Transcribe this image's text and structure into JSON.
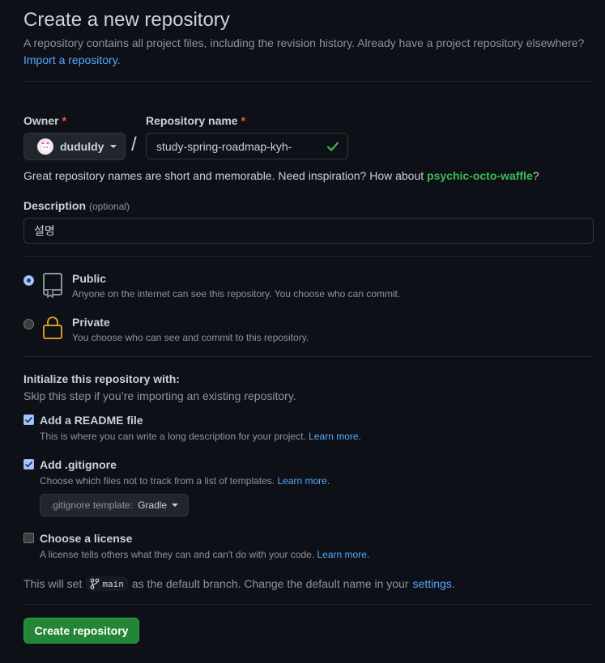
{
  "header": {
    "title": "Create a new repository",
    "subtitle": "A repository contains all project files, including the revision history. Already have a project repository elsewhere?",
    "import_link": "Import a repository."
  },
  "owner": {
    "label": "Owner",
    "required_mark": "*",
    "value": "duduldy"
  },
  "repo_name": {
    "label": "Repository name",
    "required_mark": "*",
    "value": "study-spring-roadmap-kyh-"
  },
  "hint": {
    "prefix": "Great repository names are short and memorable. Need inspiration? How about ",
    "suggestion": "psychic-octo-waffle",
    "suffix": "?"
  },
  "description": {
    "label": "Description",
    "optional": "(optional)",
    "value": "설명"
  },
  "visibility": {
    "public": {
      "title": "Public",
      "desc": "Anyone on the internet can see this repository. You choose who can commit.",
      "selected": true
    },
    "private": {
      "title": "Private",
      "desc": "You choose who can see and commit to this repository.",
      "selected": false
    }
  },
  "init": {
    "title": "Initialize this repository with:",
    "subtitle": "Skip this step if you’re importing an existing repository.",
    "readme": {
      "title": "Add a README file",
      "desc": "This is where you can write a long description for your project.",
      "link": "Learn more.",
      "checked": true
    },
    "gitignore": {
      "title": "Add .gitignore",
      "desc": "Choose which files not to track from a list of templates.",
      "link": "Learn more.",
      "checked": true,
      "template_label": ".gitignore template:",
      "template_value": "Gradle"
    },
    "license": {
      "title": "Choose a license",
      "desc": "A license tells others what they can and can't do with your code.",
      "link": "Learn more.",
      "checked": false
    }
  },
  "branch": {
    "prefix": "This will set",
    "name": "main",
    "middle": "as the default branch. Change the default name in your",
    "link": "settings",
    "suffix": "."
  },
  "submit": {
    "label": "Create repository"
  },
  "colors": {
    "background": "#0d1117",
    "accent_link": "#58a6ff",
    "success": "#3fb950",
    "button_green": "#238636",
    "required": "#f85149",
    "lock_icon": "#d29922"
  }
}
